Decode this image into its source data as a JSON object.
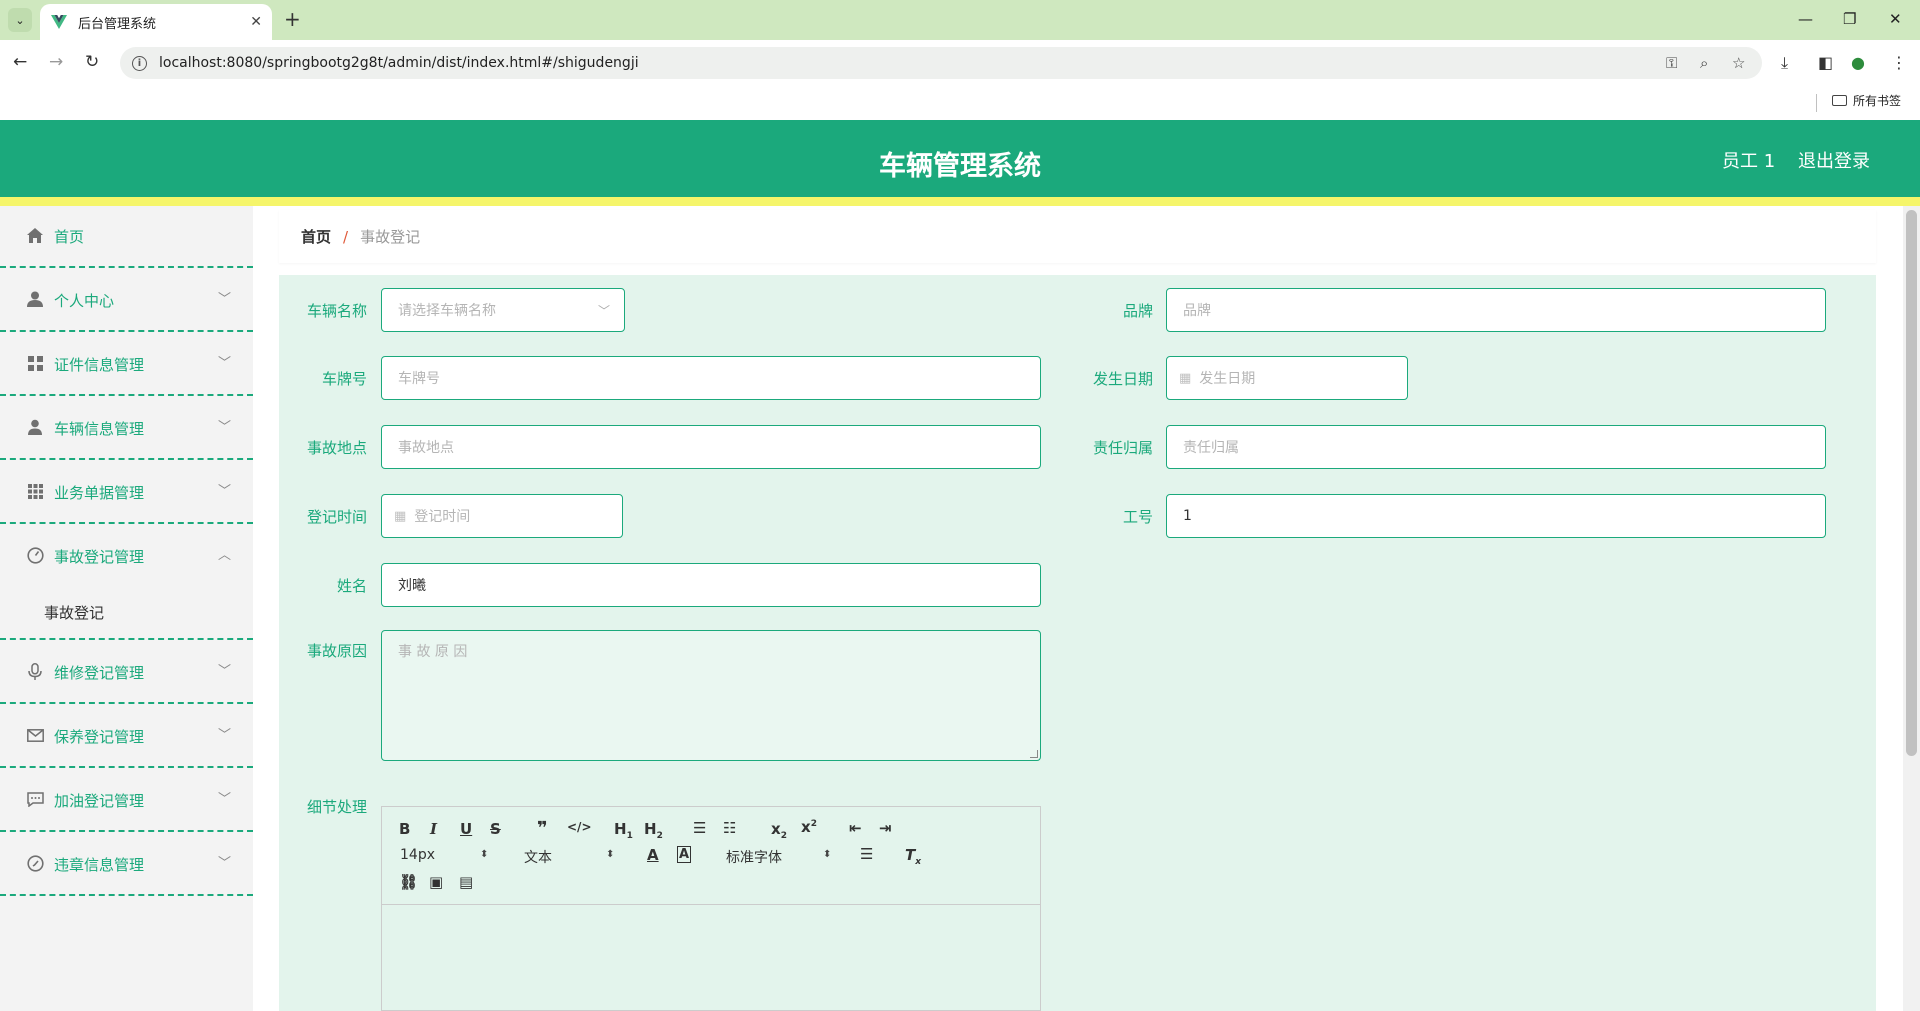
{
  "browser": {
    "tab_title": "后台管理系统",
    "url": "localhost:8080/springbootg2g8t/admin/dist/index.html#/shigudengji",
    "bookmarks_label": "所有书签"
  },
  "header": {
    "title": "车辆管理系统",
    "user": "员工 1",
    "logout": "退出登录",
    "color": "#1ba97c",
    "stripe_color": "#f5f56a"
  },
  "sidebar": {
    "items": [
      {
        "label": "首页",
        "icon": "home-icon"
      },
      {
        "label": "个人中心",
        "icon": "user-icon"
      },
      {
        "label": "证件信息管理",
        "icon": "grid-icon"
      },
      {
        "label": "车辆信息管理",
        "icon": "person-icon"
      },
      {
        "label": "业务单据管理",
        "icon": "apps-icon"
      },
      {
        "label": "事故登记管理",
        "icon": "dashboard-icon",
        "expanded": true
      },
      {
        "label": "维修登记管理",
        "icon": "microphone-icon"
      },
      {
        "label": "保养登记管理",
        "icon": "mail-icon"
      },
      {
        "label": "加油登记管理",
        "icon": "chat-icon"
      },
      {
        "label": "违章信息管理",
        "icon": "compass-icon"
      }
    ],
    "submenu": {
      "accident_register": "事故登记"
    }
  },
  "breadcrumb": {
    "home": "首页",
    "sep": "/",
    "current": "事故登记"
  },
  "form": {
    "vehicle_name": {
      "label": "车辆名称",
      "placeholder": "请选择车辆名称"
    },
    "brand": {
      "label": "品牌",
      "placeholder": "品牌"
    },
    "plate": {
      "label": "车牌号",
      "placeholder": "车牌号"
    },
    "date": {
      "label": "发生日期",
      "placeholder": "发生日期"
    },
    "location": {
      "label": "事故地点",
      "placeholder": "事故地点"
    },
    "responsibility": {
      "label": "责任归属",
      "placeholder": "责任归属"
    },
    "register_time": {
      "label": "登记时间",
      "placeholder": "登记时间"
    },
    "employee_no": {
      "label": "工号",
      "value": "1"
    },
    "name": {
      "label": "姓名",
      "value": "刘曦"
    },
    "reason": {
      "label": "事故原因",
      "placeholder": "事 故 原 因"
    },
    "detail": {
      "label": "细节处理"
    }
  },
  "editor": {
    "font_size": "14px",
    "format": "文本",
    "font": "标准字体"
  }
}
